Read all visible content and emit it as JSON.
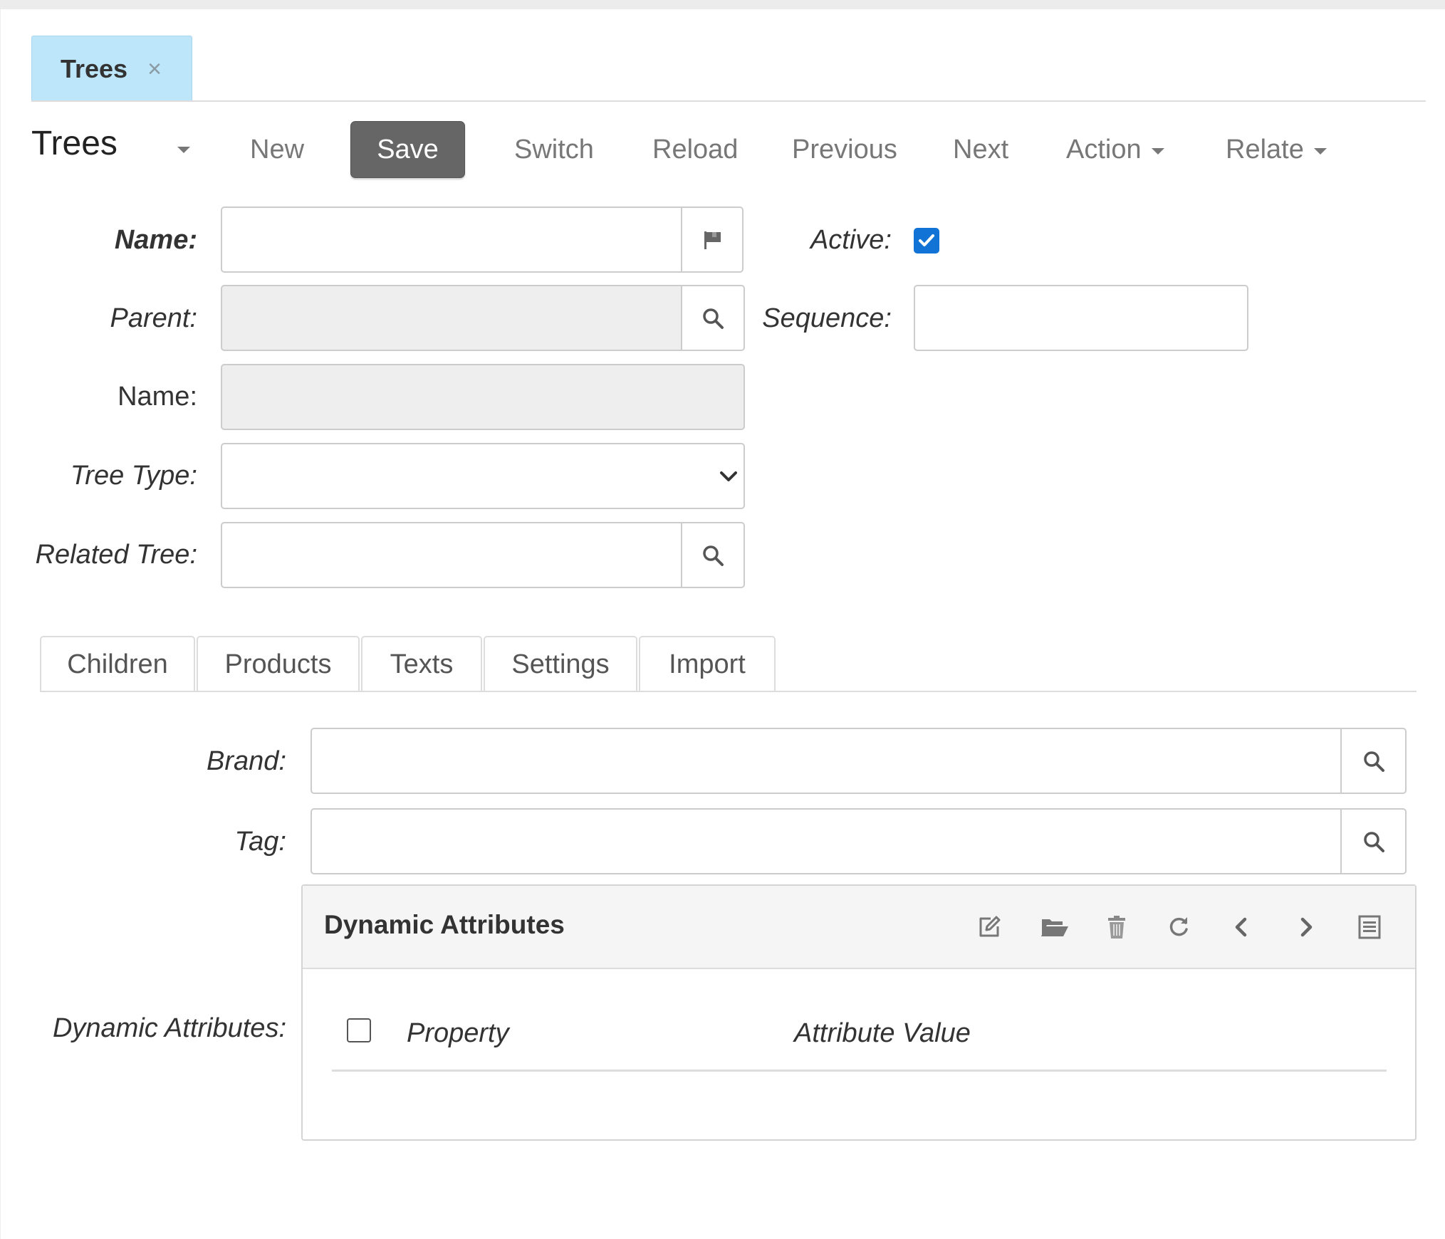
{
  "tabbar": {
    "tabs": [
      {
        "label": "Trees",
        "close_glyph": "×",
        "active": true
      }
    ]
  },
  "toolbar": {
    "title": "Trees",
    "title_menu_icon": "caret-down-icon",
    "new_label": "New",
    "save_label": "Save",
    "switch_label": "Switch",
    "reload_label": "Reload",
    "previous_label": "Previous",
    "next_label": "Next",
    "action_label": "Action",
    "relate_label": "Relate"
  },
  "form": {
    "name": {
      "label": "Name:",
      "value": "",
      "addon_icon": "flag-icon",
      "required": true
    },
    "parent": {
      "label": "Parent:",
      "value": "",
      "addon_icon": "search-icon",
      "readonly": true
    },
    "parent_name": {
      "label": "Name:",
      "value": "",
      "readonly": true
    },
    "tree_type": {
      "label": "Tree Type:",
      "selected": "",
      "icon": "chevron-down-icon"
    },
    "related_tree": {
      "label": "Related Tree:",
      "value": "",
      "addon_icon": "search-icon"
    },
    "active": {
      "label": "Active:",
      "checked": true
    },
    "sequence": {
      "label": "Sequence:",
      "value": ""
    }
  },
  "form_tabs": [
    {
      "label": "Children"
    },
    {
      "label": "Products"
    },
    {
      "label": "Texts"
    },
    {
      "label": "Settings"
    },
    {
      "label": "Import"
    }
  ],
  "settings_tab": {
    "brand": {
      "label": "Brand:",
      "value": "",
      "addon_icon": "search-icon"
    },
    "tag": {
      "label": "Tag:",
      "value": "",
      "addon_icon": "search-icon"
    },
    "dynamic_attributes": {
      "label": "Dynamic Attributes:",
      "panel_title": "Dynamic Attributes",
      "panel_icons": [
        "edit-icon",
        "folder-open-icon",
        "trash-icon",
        "refresh-icon",
        "chevron-left-icon",
        "chevron-right-icon",
        "list-icon"
      ],
      "columns": [
        "Property",
        "Attribute Value"
      ],
      "rows": []
    }
  },
  "colors": {
    "tab_active_bg": "#bde6fb",
    "save_button_bg": "#666666",
    "checkbox_checked": "#1273d6",
    "readonly_field_bg": "#eeeeee"
  }
}
